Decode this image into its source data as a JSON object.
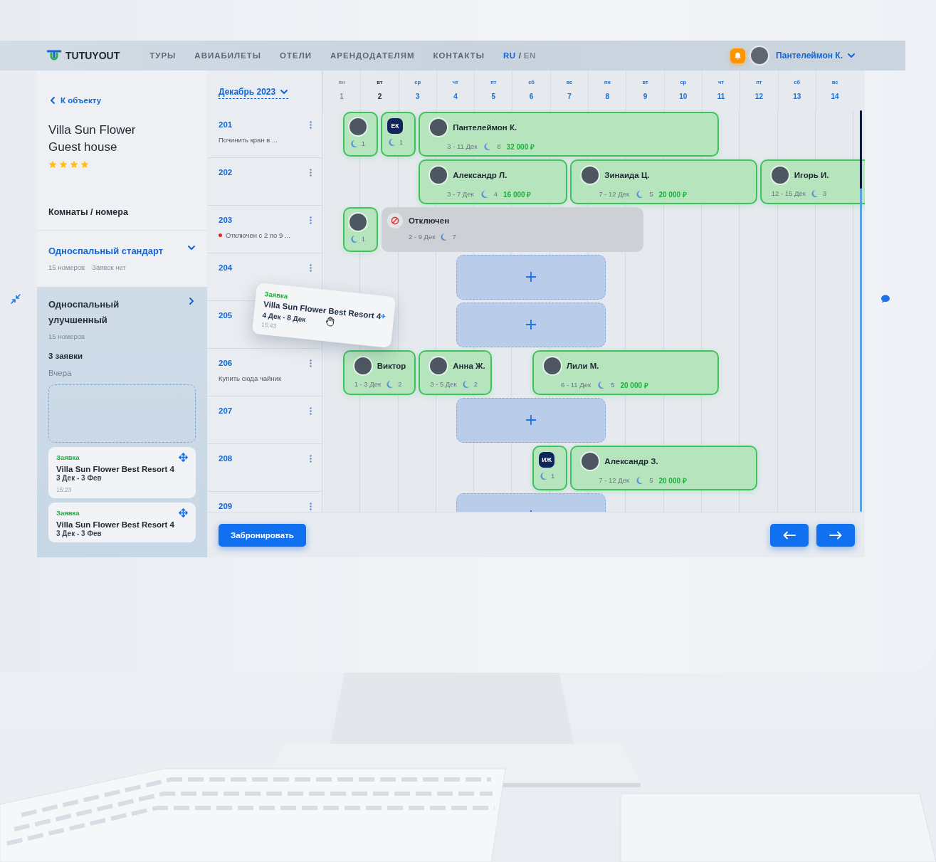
{
  "header": {
    "logo": "TUTUYOUT",
    "nav": [
      {
        "label": "ТУРЫ"
      },
      {
        "label": "АВИАБИЛЕТЫ"
      },
      {
        "label": "ОТЕЛИ"
      },
      {
        "label": "АРЕНДОДАТЕЛЯМ"
      },
      {
        "label": "КОНТАКТЫ"
      }
    ],
    "languages": [
      {
        "label": "RU",
        "selected": true
      },
      {
        "label": "EN",
        "selected": false
      }
    ],
    "language_separator": "/",
    "user": {
      "name": "Пантелеймон К."
    }
  },
  "sidebar": {
    "back_link": "К объекту",
    "property_title": "Villa Sun Flower Guest house",
    "stars": 4,
    "section_title": "Комнаты / номера",
    "categories": [
      {
        "name": "Односпальный стандарт",
        "rooms": "15 номеров",
        "requests": "Заявок нет",
        "selected": false,
        "expanded": true
      },
      {
        "name": "Односпальный улучшенный",
        "rooms": "15 номеров",
        "selected": true,
        "expanded": false
      }
    ],
    "requests_count": "3 заявки",
    "day_group": "Вчера",
    "requests": [
      {
        "label": "Заявка",
        "title": "Villa Sun Flower Best Resort 4",
        "dates": "3 Дек - 3 Фев",
        "time": "15:23"
      },
      {
        "label": "Заявка",
        "title": "Villa Sun Flower Best Resort 4",
        "dates": "3 Дек - 3 Фев"
      }
    ]
  },
  "calendar": {
    "month": "Декабрь 2023",
    "days": [
      {
        "weekday": "пн",
        "number": "1",
        "past": true,
        "today": false
      },
      {
        "weekday": "вт",
        "number": "2",
        "past": false,
        "today": true
      },
      {
        "weekday": "ср",
        "number": "3",
        "past": false,
        "today": false
      },
      {
        "weekday": "чт",
        "number": "4",
        "past": false,
        "today": false
      },
      {
        "weekday": "пт",
        "number": "5",
        "past": false,
        "today": false
      },
      {
        "weekday": "сб",
        "number": "6",
        "past": false,
        "today": false
      },
      {
        "weekday": "вс",
        "number": "7",
        "past": false,
        "today": false
      },
      {
        "weekday": "пн",
        "number": "8",
        "past": false,
        "today": false
      },
      {
        "weekday": "вт",
        "number": "9",
        "past": false,
        "today": false
      },
      {
        "weekday": "ср",
        "number": "10",
        "past": false,
        "today": false
      },
      {
        "weekday": "чт",
        "number": "11",
        "past": false,
        "today": false
      },
      {
        "weekday": "пт",
        "number": "12",
        "past": false,
        "today": false
      },
      {
        "weekday": "сб",
        "number": "13",
        "past": false,
        "today": false
      },
      {
        "weekday": "вс",
        "number": "14",
        "past": false,
        "today": false
      }
    ],
    "rooms": [
      {
        "number": "201",
        "note": "Починить кран в ...",
        "disabled": false,
        "bookings": [
          {
            "kind": "short",
            "nights": "1"
          },
          {
            "kind": "short",
            "initials": "ЕК",
            "nights": "1"
          },
          {
            "kind": "guest",
            "name": "Пантелеймон К.",
            "dates": "3 - 11 Дек",
            "nights": "8",
            "price": "32 000 ₽"
          }
        ]
      },
      {
        "number": "202",
        "disabled": false,
        "bookings": [
          {
            "kind": "guest",
            "name": "Александр Л.",
            "dates": "3 - 7 Дек",
            "nights": "4",
            "price": "16 000 ₽"
          },
          {
            "kind": "guest",
            "name": "Зинаида Ц.",
            "dates": "7 - 12 Дек",
            "nights": "5",
            "price": "20 000 ₽"
          },
          {
            "kind": "guest",
            "name": "Игорь И.",
            "dates": "12 - 15 Дек",
            "nights": "3"
          }
        ]
      },
      {
        "number": "203",
        "note": "Отключен с 2 по 9 ...",
        "disabled": true,
        "bookings": [
          {
            "kind": "short",
            "nights": "1"
          },
          {
            "kind": "blocked",
            "title": "Отключен",
            "dates": "2 - 9 Дек",
            "nights": "7"
          }
        ]
      },
      {
        "number": "204",
        "disabled": false,
        "bookings": [
          {
            "kind": "empty"
          }
        ]
      },
      {
        "number": "205",
        "disabled": false,
        "bookings": [
          {
            "kind": "empty"
          }
        ]
      },
      {
        "number": "206",
        "note": "Купить сюда чайник",
        "disabled": false,
        "bookings": [
          {
            "kind": "guest",
            "name": "Виктор",
            "dates": "1 - 3 Дек",
            "nights": "2"
          },
          {
            "kind": "guest",
            "name": "Анна Ж.",
            "dates": "3 - 5 Дек",
            "nights": "2"
          },
          {
            "kind": "guest",
            "name": "Лили М.",
            "dates": "6 - 11 Дек",
            "nights": "5",
            "price": "20 000 ₽"
          }
        ]
      },
      {
        "number": "207",
        "disabled": false,
        "bookings": [
          {
            "kind": "empty"
          }
        ]
      },
      {
        "number": "208",
        "disabled": false,
        "bookings": [
          {
            "kind": "short",
            "initials": "ИЖ",
            "nights": "1"
          },
          {
            "kind": "guest",
            "name": "Александр З.",
            "dates": "7 - 12 Дек",
            "nights": "5",
            "price": "20 000 ₽"
          }
        ]
      },
      {
        "number": "209",
        "disabled": false,
        "bookings": [
          {
            "kind": "empty"
          }
        ]
      }
    ]
  },
  "dragged_request": {
    "label": "Заявка",
    "title": "Villa Sun Flower Best Resort 4",
    "dates": "4 Дек - 8 Дек",
    "time": "15:43"
  },
  "footer": {
    "book_button": "Забронировать"
  }
}
